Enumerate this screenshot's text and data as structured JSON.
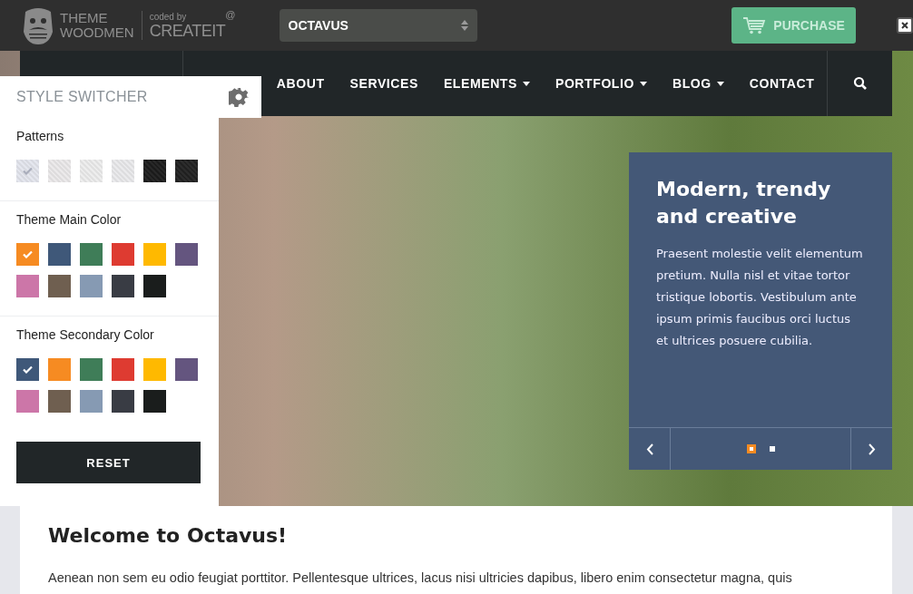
{
  "top_bar": {
    "logo_lines": [
      "THEME",
      "WOODMEN"
    ],
    "credit_small": "coded by",
    "credit_brand": "CREATEIT",
    "credit_mark": "@",
    "theme_select": {
      "value": "OCTAVUS"
    },
    "purchase_button": "PURCHASE"
  },
  "nav": {
    "items": [
      {
        "label": "ABOUT",
        "dropdown": false
      },
      {
        "label": "SERVICES",
        "dropdown": false
      },
      {
        "label": "ELEMENTS",
        "dropdown": true
      },
      {
        "label": "PORTFOLIO",
        "dropdown": true
      },
      {
        "label": "BLOG",
        "dropdown": true
      },
      {
        "label": "CONTACT",
        "dropdown": false
      }
    ]
  },
  "style_switcher": {
    "title": "STYLE SWITCHER",
    "sections": [
      {
        "kind": "patterns",
        "label": "Patterns",
        "swatches": [
          {
            "color": "#e4e6ee",
            "selected": true
          },
          {
            "color": "#ebe9ea",
            "selected": false
          },
          {
            "color": "#ededed",
            "selected": false
          },
          {
            "color": "#eaeaec",
            "selected": false
          },
          {
            "color": "#1b1b1b",
            "selected": false
          },
          {
            "color": "#202020",
            "selected": false
          }
        ]
      },
      {
        "kind": "colors",
        "label": "Theme Main Color",
        "swatches": [
          {
            "color": "#f68b22",
            "selected": true
          },
          {
            "color": "#3f5879",
            "selected": false
          },
          {
            "color": "#3f7d58",
            "selected": false
          },
          {
            "color": "#de3b31",
            "selected": false
          },
          {
            "color": "#ffb900",
            "selected": false
          },
          {
            "color": "#64557f",
            "selected": false
          },
          {
            "color": "#cc76a8",
            "selected": false
          },
          {
            "color": "#6f5f50",
            "selected": false
          },
          {
            "color": "#869ab3",
            "selected": false
          },
          {
            "color": "#393c44",
            "selected": false
          },
          {
            "color": "#1a1d1c",
            "selected": false
          }
        ]
      },
      {
        "kind": "colors",
        "label": "Theme Secondary Color",
        "swatches": [
          {
            "color": "#3f5879",
            "selected": true
          },
          {
            "color": "#f68b22",
            "selected": false
          },
          {
            "color": "#3f7d58",
            "selected": false
          },
          {
            "color": "#de3b31",
            "selected": false
          },
          {
            "color": "#ffb900",
            "selected": false
          },
          {
            "color": "#64557f",
            "selected": false
          },
          {
            "color": "#cc76a8",
            "selected": false
          },
          {
            "color": "#6f5f50",
            "selected": false
          },
          {
            "color": "#869ab3",
            "selected": false
          },
          {
            "color": "#393c44",
            "selected": false
          },
          {
            "color": "#1a1d1c",
            "selected": false
          }
        ]
      }
    ],
    "reset_button": "RESET"
  },
  "slider": {
    "title": "Modern, trendy and creative",
    "text": "Praesent molestie velit elementum pretium. Nulla nisl et vitae tortor tristique lobortis. Vestibulum ante ipsum primis faucibus orci luctus et ultrices posuere cubilia.",
    "dots": [
      {
        "selected": true
      },
      {
        "selected": false
      }
    ]
  },
  "welcome": {
    "heading": "Welcome to Octavus!",
    "text": "Aenean non sem eu odio feugiat porttitor. Pellentesque ultrices, lacus nisi ultricies dapibus, libero enim consectetur magna, quis"
  }
}
